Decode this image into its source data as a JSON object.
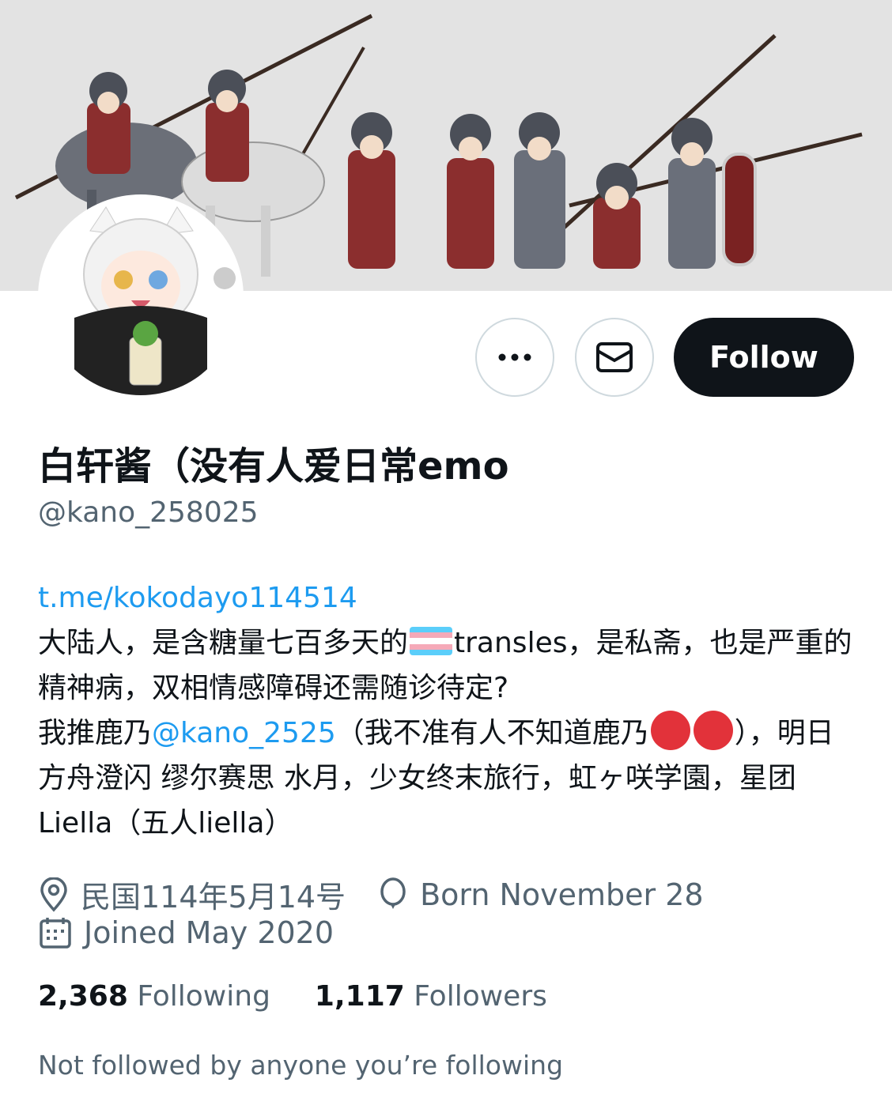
{
  "profile": {
    "display_name": "白轩酱（没有人爱日常emo",
    "handle": "@kano_258025",
    "follow_label": "Follow",
    "more_icon": "more-icon",
    "message_icon": "mail-icon"
  },
  "bio": {
    "link": "t.me/kokodayo114514",
    "line1_a": "大陆人，是含糖量七百多天的",
    "line1_b": "transles，是私斋，也是严重的精神病，双相情感障碍还需随诊待定?",
    "line2_a": "我推鹿乃",
    "mention": "@kano_2525",
    "line2_b": "（我不准有人不知道鹿乃",
    "line2_c": "），明日方舟澄闪 缪尔赛思 水月，少女终末旅行，虹ヶ咲学園，星团Liella（五人liella）",
    "flag_colors": [
      "#5bcefa",
      "#f5a9b8",
      "#ffffff",
      "#f5a9b8",
      "#5bcefa"
    ]
  },
  "meta": {
    "location": "民国114年5月14号",
    "birthday": "Born November 28",
    "joined": "Joined May 2020"
  },
  "stats": {
    "following_count": "2,368",
    "following_label": "Following",
    "followers_count": "1,117",
    "followers_label": "Followers"
  },
  "not_followed_text": "Not followed by anyone you’re following",
  "colors": {
    "text": "#0f1419",
    "secondary": "#536471",
    "link": "#1d9bf0",
    "button": "#0f1419"
  }
}
